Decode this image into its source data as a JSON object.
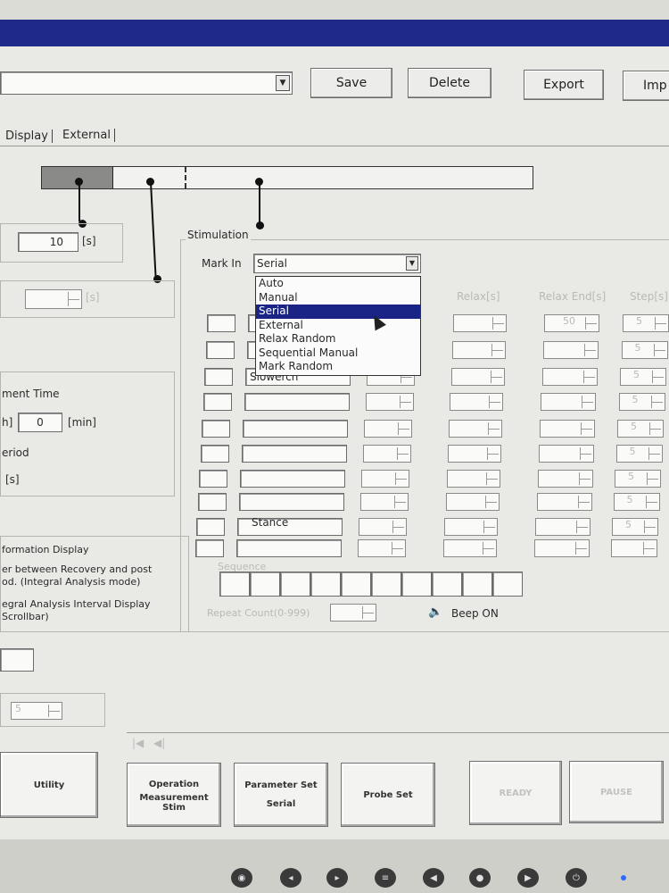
{
  "toolbar": {
    "save_label": "Save",
    "delete_label": "Delete",
    "export_label": "Export",
    "import_label": "Imp"
  },
  "tabs": [
    {
      "label": "Display"
    },
    {
      "label": "External"
    }
  ],
  "timer": {
    "value": "10",
    "unit": "[s]",
    "disabled_unit": "[s]"
  },
  "stimulation": {
    "group_label": "Stimulation",
    "mark_in_label": "Mark In",
    "mark_in_value": "Serial",
    "options": [
      "Auto",
      "Manual",
      "Serial",
      "External",
      "Relax Random",
      "Sequential Manual",
      "Mark Random"
    ],
    "selected_index": 2,
    "col_relax": "Relax[s]",
    "col_relax_end": "Relax End[s]",
    "col_step": "Step[s]",
    "row_slowerch": "Slowerch",
    "row_stance": "Stance",
    "sequence_label": "Sequence",
    "repeat_count_label": "Repeat Count(0-999)",
    "beep_label": "Beep ON",
    "rows_relax_end": [
      "50"
    ],
    "rows_step": [
      "5",
      "5",
      "5",
      "5",
      "5",
      "5",
      "5",
      "5",
      "5"
    ]
  },
  "left_panel": {
    "measurement_time_label": "ment Time",
    "hour_unit": "h]",
    "minute_value": "0",
    "minute_unit": "[min]",
    "period_label": "eriod",
    "period_unit": "[s]",
    "info_display_label": "formation Display",
    "info_line1": "er between Recovery and post",
    "info_line2": "od. (Integral Analysis mode)",
    "info_line3": "egral Analysis Interval Display",
    "info_line4": "Scrollbar)",
    "spin_value": "5"
  },
  "bottom_buttons": {
    "utility": "Utility",
    "operation_title": "Operation",
    "operation_line2": "Measurement",
    "operation_line3": "Stim",
    "param_title": "Parameter Set",
    "param_sub": "Serial",
    "probe": "Probe Set",
    "ready": "READY",
    "pause": "PAUSE"
  },
  "colors": {
    "selection": "#1a2487",
    "title_bar": "#1f2a88"
  }
}
